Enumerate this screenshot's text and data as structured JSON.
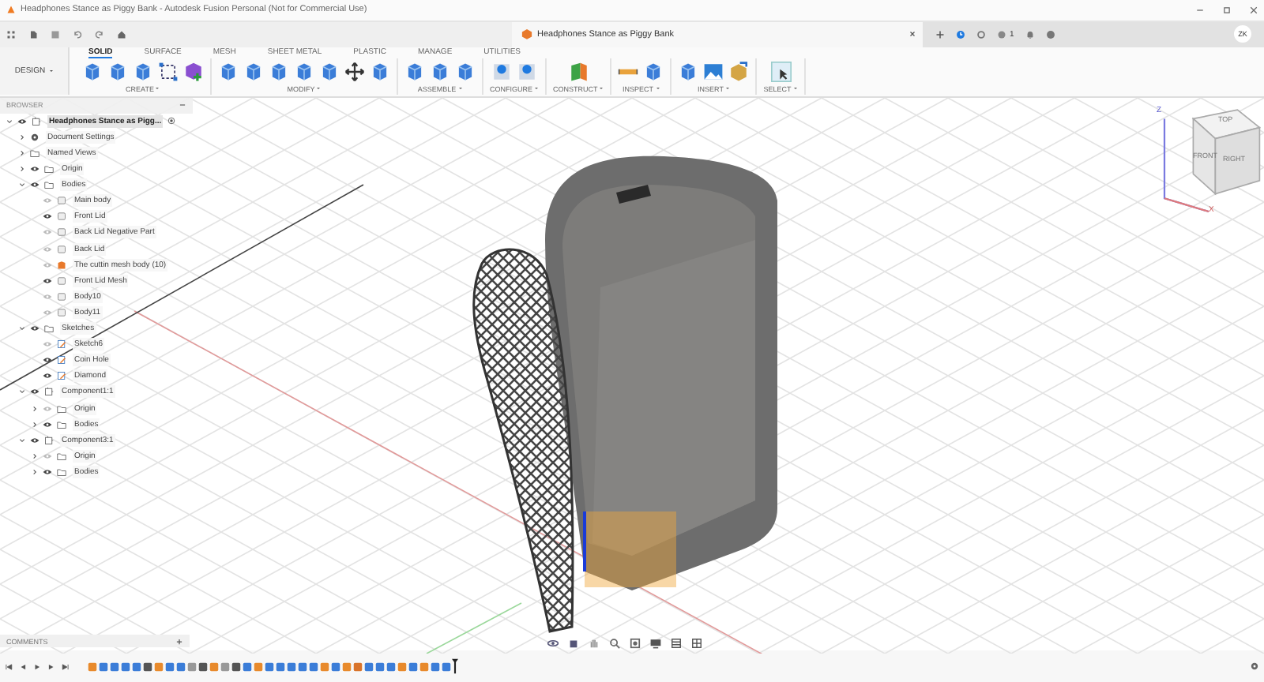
{
  "window": {
    "title": "Headphones Stance as Piggy Bank - Autodesk Fusion Personal (Not for Commercial Use)"
  },
  "document_tab": {
    "title": "Headphones Stance as Piggy Bank"
  },
  "header": {
    "job_count": "1",
    "avatar": "ZK"
  },
  "workspace": {
    "label": "DESIGN"
  },
  "ribbon_tabs": [
    {
      "label": "SOLID",
      "selected": true
    },
    {
      "label": "SURFACE",
      "selected": false
    },
    {
      "label": "MESH",
      "selected": false
    },
    {
      "label": "SHEET METAL",
      "selected": false
    },
    {
      "label": "PLASTIC",
      "selected": false
    },
    {
      "label": "MANAGE",
      "selected": false
    },
    {
      "label": "UTILITIES",
      "selected": false
    }
  ],
  "ribbon_groups": [
    {
      "label": "CREATE"
    },
    {
      "label": "MODIFY"
    },
    {
      "label": "ASSEMBLE"
    },
    {
      "label": "CONFIGURE"
    },
    {
      "label": "CONSTRUCT"
    },
    {
      "label": "INSPECT"
    },
    {
      "label": "INSERT"
    },
    {
      "label": "SELECT"
    }
  ],
  "browser": {
    "title": "BROWSER",
    "tree": [
      {
        "label": "Headphones Stance as Pigg...",
        "kind": "document",
        "selected": true,
        "visible": true,
        "expanded": true,
        "children": [
          {
            "label": "Document Settings",
            "kind": "settings",
            "expanded": false
          },
          {
            "label": "Named Views",
            "kind": "folder",
            "expanded": false
          },
          {
            "label": "Origin",
            "kind": "folder",
            "visible": true,
            "expanded": false
          },
          {
            "label": "Bodies",
            "kind": "folder",
            "visible": true,
            "expanded": true,
            "children": [
              {
                "label": "Main body",
                "kind": "body",
                "visible": false
              },
              {
                "label": "Front Lid",
                "kind": "body",
                "visible": true
              },
              {
                "label": "Back Lid Negative Part",
                "kind": "body",
                "visible": false
              },
              {
                "label": "Back Lid",
                "kind": "body",
                "visible": false
              },
              {
                "label": "The cuttin mesh body (10)",
                "kind": "mesh",
                "visible": false
              },
              {
                "label": "Front Lid Mesh",
                "kind": "body",
                "visible": true
              },
              {
                "label": "Body10",
                "kind": "body",
                "visible": false
              },
              {
                "label": "Body11",
                "kind": "body",
                "visible": false
              }
            ]
          },
          {
            "label": "Sketches",
            "kind": "folder",
            "visible": true,
            "expanded": true,
            "children": [
              {
                "label": "Sketch6",
                "kind": "sketch",
                "visible": false
              },
              {
                "label": "Coin Hole",
                "kind": "sketch",
                "visible": true
              },
              {
                "label": "Diamond",
                "kind": "sketch",
                "visible": true
              }
            ]
          },
          {
            "label": "Component1:1",
            "kind": "component",
            "visible": true,
            "expanded": true,
            "children": [
              {
                "label": "Origin",
                "kind": "folder",
                "visible": false,
                "expanded": false
              },
              {
                "label": "Bodies",
                "kind": "folder",
                "visible": true,
                "expanded": false
              }
            ]
          },
          {
            "label": "Component3:1",
            "kind": "component",
            "visible": true,
            "expanded": true,
            "children": [
              {
                "label": "Origin",
                "kind": "folder",
                "visible": false,
                "expanded": false
              },
              {
                "label": "Bodies",
                "kind": "folder",
                "visible": true,
                "expanded": false
              }
            ]
          }
        ]
      }
    ]
  },
  "viewcube": {
    "faces": [
      "TOP",
      "FRONT",
      "RIGHT"
    ],
    "axes": [
      "Z",
      "X"
    ]
  },
  "comments": {
    "title": "COMMENTS"
  }
}
